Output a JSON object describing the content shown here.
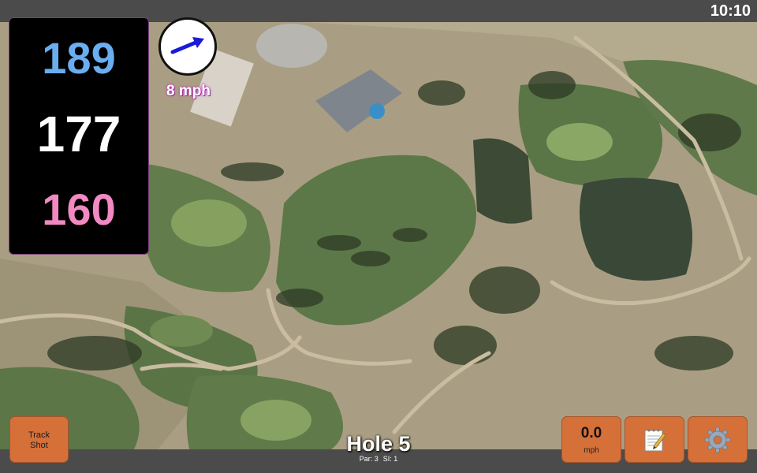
{
  "status": {
    "time": "10:10"
  },
  "distances": {
    "back": "189",
    "middle": "177",
    "front": "160"
  },
  "wind": {
    "speed": "8 mph",
    "icon": "wind-arrow-icon"
  },
  "hole": {
    "title": "Hole 5",
    "par": "Par: 3",
    "si": "SI: 1"
  },
  "buttons": {
    "track_line1": "Track",
    "track_line2": "Shot",
    "speed_value": "0.0",
    "speed_unit": "mph",
    "notes_icon": "notepad-icon",
    "settings_icon": "gear-icon"
  },
  "colors": {
    "back": "#6aaef0",
    "middle": "#ffffff",
    "front": "#f189c2",
    "button": "#d57039",
    "wind_arrow": "#1a1ad8"
  }
}
